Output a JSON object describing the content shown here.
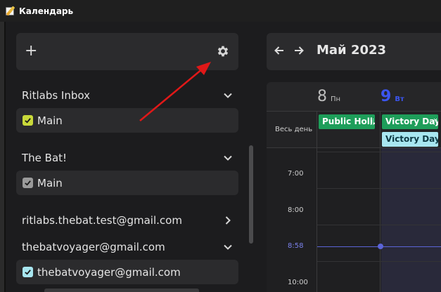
{
  "window": {
    "title": "Календарь"
  },
  "sidebar": {
    "add_label": "+",
    "sections": [
      {
        "name": "Ritlabs Inbox",
        "expanded": true,
        "calendars": [
          {
            "name": "Main",
            "checked": true,
            "color": "#c9d93a"
          }
        ]
      },
      {
        "name": "The Bat!",
        "expanded": true,
        "calendars": [
          {
            "name": "Main",
            "checked": true,
            "color": "#9a9a9a"
          }
        ]
      },
      {
        "name": "ritlabs.thebat.test@gmail.com",
        "expanded": false,
        "calendars": []
      },
      {
        "name": "thebatvoyager@gmail.com",
        "expanded": true,
        "calendars": [
          {
            "name": "thebatvoyager@gmail.com",
            "checked": true,
            "color": "#a8e6f0"
          }
        ]
      }
    ]
  },
  "calendar": {
    "month_label": "Май 2023",
    "days": [
      {
        "num": "8",
        "name": "Пн",
        "color": "#bdbdbd"
      },
      {
        "num": "9",
        "name": "Вт",
        "color": "#3b55f0"
      }
    ],
    "allday_label": "Весь день",
    "events": [
      {
        "title": "Public Holi...",
        "style": "green"
      },
      {
        "title": "Victory Day",
        "style": "green"
      },
      {
        "title": "Victory Day",
        "style": "light"
      }
    ],
    "times": [
      "7:00",
      "8:00",
      "10:00"
    ],
    "now_label": "8:58"
  },
  "colors": {
    "accent": "#3b55f0",
    "now": "#5b64d8",
    "arrow": "#e01818"
  }
}
